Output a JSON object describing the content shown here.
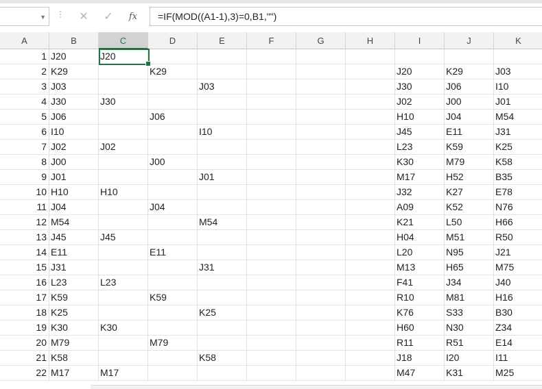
{
  "name_box": {
    "value": ""
  },
  "formula_bar": {
    "cancel_glyph": "✕",
    "enter_glyph": "✓",
    "fx_label": "fx",
    "formula": "=IF(MOD((A1-1),3)=0,B1,\"\")"
  },
  "columns": [
    "A",
    "B",
    "C",
    "D",
    "E",
    "F",
    "G",
    "H",
    "I",
    "J",
    "K"
  ],
  "selected_column": "C",
  "rows": [
    {
      "A": "1",
      "B": "J20",
      "C": "J20",
      "D": "",
      "E": "",
      "I": "",
      "J": "",
      "K": ""
    },
    {
      "A": "2",
      "B": "K29",
      "C": "",
      "D": "K29",
      "E": "",
      "I": "J20",
      "J": "K29",
      "K": "J03"
    },
    {
      "A": "3",
      "B": "J03",
      "C": "",
      "D": "",
      "E": "J03",
      "I": "J30",
      "J": "J06",
      "K": "I10"
    },
    {
      "A": "4",
      "B": "J30",
      "C": "J30",
      "D": "",
      "E": "",
      "I": "J02",
      "J": "J00",
      "K": "J01"
    },
    {
      "A": "5",
      "B": "J06",
      "C": "",
      "D": "J06",
      "E": "",
      "I": "H10",
      "J": "J04",
      "K": "M54"
    },
    {
      "A": "6",
      "B": "I10",
      "C": "",
      "D": "",
      "E": "I10",
      "I": "J45",
      "J": "E11",
      "K": "J31"
    },
    {
      "A": "7",
      "B": "J02",
      "C": "J02",
      "D": "",
      "E": "",
      "I": "L23",
      "J": "K59",
      "K": "K25"
    },
    {
      "A": "8",
      "B": "J00",
      "C": "",
      "D": "J00",
      "E": "",
      "I": "K30",
      "J": "M79",
      "K": "K58"
    },
    {
      "A": "9",
      "B": "J01",
      "C": "",
      "D": "",
      "E": "J01",
      "I": "M17",
      "J": "H52",
      "K": "B35"
    },
    {
      "A": "10",
      "B": "H10",
      "C": "H10",
      "D": "",
      "E": "",
      "I": "J32",
      "J": "K27",
      "K": "E78"
    },
    {
      "A": "11",
      "B": "J04",
      "C": "",
      "D": "J04",
      "E": "",
      "I": "A09",
      "J": "K52",
      "K": "N76"
    },
    {
      "A": "12",
      "B": "M54",
      "C": "",
      "D": "",
      "E": "M54",
      "I": "K21",
      "J": "L50",
      "K": "H66"
    },
    {
      "A": "13",
      "B": "J45",
      "C": "J45",
      "D": "",
      "E": "",
      "I": "H04",
      "J": "M51",
      "K": "R50"
    },
    {
      "A": "14",
      "B": "E11",
      "C": "",
      "D": "E11",
      "E": "",
      "I": "L20",
      "J": "N95",
      "K": "J21"
    },
    {
      "A": "15",
      "B": "J31",
      "C": "",
      "D": "",
      "E": "J31",
      "I": "M13",
      "J": "H65",
      "K": "M75"
    },
    {
      "A": "16",
      "B": "L23",
      "C": "L23",
      "D": "",
      "E": "",
      "I": "F41",
      "J": "J34",
      "K": "J40"
    },
    {
      "A": "17",
      "B": "K59",
      "C": "",
      "D": "K59",
      "E": "",
      "I": "R10",
      "J": "M81",
      "K": "H16"
    },
    {
      "A": "18",
      "B": "K25",
      "C": "",
      "D": "",
      "E": "K25",
      "I": "K76",
      "J": "S33",
      "K": "B30"
    },
    {
      "A": "19",
      "B": "K30",
      "C": "K30",
      "D": "",
      "E": "",
      "I": "H60",
      "J": "N30",
      "K": "Z34"
    },
    {
      "A": "20",
      "B": "M79",
      "C": "",
      "D": "M79",
      "E": "",
      "I": "R11",
      "J": "R51",
      "K": "E14"
    },
    {
      "A": "21",
      "B": "K58",
      "C": "",
      "D": "",
      "E": "K58",
      "I": "J18",
      "J": "I20",
      "K": "I11"
    },
    {
      "A": "22",
      "B": "M17",
      "C": "M17",
      "D": "",
      "E": "",
      "I": "M47",
      "J": "K31",
      "K": "M25"
    }
  ]
}
